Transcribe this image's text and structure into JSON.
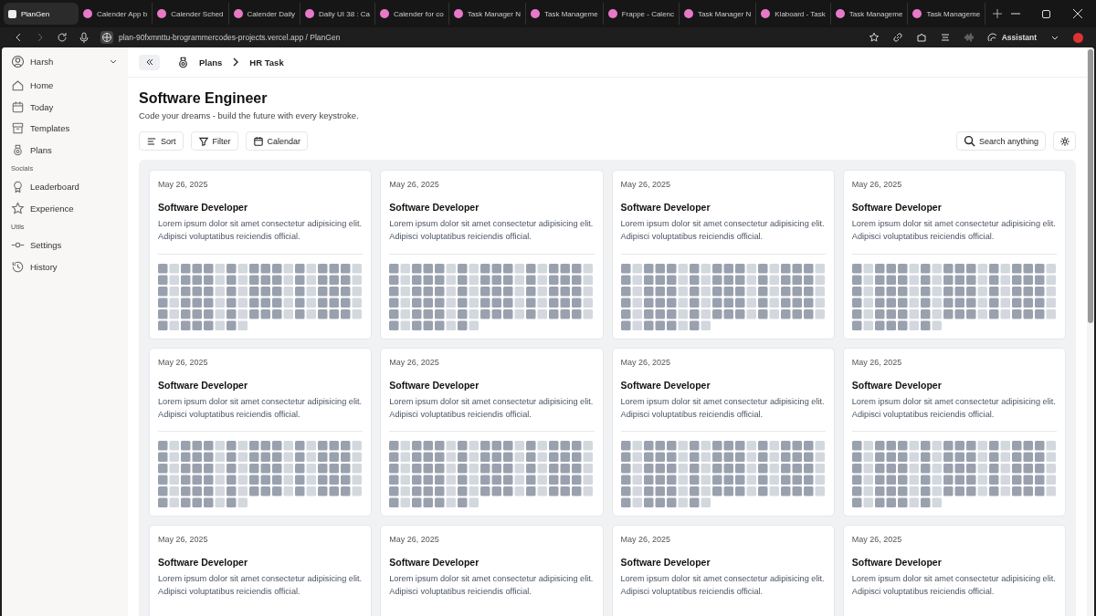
{
  "browser": {
    "tabs": [
      {
        "title": "PlanGen",
        "selected": true
      },
      {
        "title": "Calender App b",
        "selected": false
      },
      {
        "title": "Calender Sched",
        "selected": false
      },
      {
        "title": "Calender Daily",
        "selected": false
      },
      {
        "title": "Daily UI 38 : Ca",
        "selected": false
      },
      {
        "title": "Calender for co",
        "selected": false
      },
      {
        "title": "Task Manager N",
        "selected": false
      },
      {
        "title": "Task Manageme",
        "selected": false
      },
      {
        "title": "Frappe - Calenc",
        "selected": false
      },
      {
        "title": "Task Manager N",
        "selected": false
      },
      {
        "title": "Klaboard - Task",
        "selected": false
      },
      {
        "title": "Task Manageme",
        "selected": false
      },
      {
        "title": "Task Manageme",
        "selected": false
      }
    ],
    "url": "plan-90fxmnttu-brogrammercodes-projects.vercel.app / PlanGen",
    "assistant": "Assistant"
  },
  "sidebar": {
    "user": "Harsh",
    "sections": [
      {
        "items": [
          {
            "label": "Home"
          },
          {
            "label": "Today"
          },
          {
            "label": "Templates"
          },
          {
            "label": "Plans"
          }
        ]
      },
      {
        "heading": "Socials",
        "items": [
          {
            "label": "Leaderboard"
          },
          {
            "label": "Experience"
          }
        ]
      },
      {
        "heading": "Utils",
        "items": [
          {
            "label": "Settings"
          },
          {
            "label": "History"
          }
        ]
      }
    ]
  },
  "breadcrumb": [
    "Plans",
    "HR Task"
  ],
  "page": {
    "title": "Software Engineer",
    "subtitle": "Code your dreams - build the future with every keystroke."
  },
  "toolbar": {
    "buttons": [
      {
        "label": "Sort"
      },
      {
        "label": "Filter"
      },
      {
        "label": "Calendar"
      }
    ],
    "search": "Search anything"
  },
  "cards": [
    {
      "date": "May 26, 2025",
      "title": "Software Developer",
      "description": "Lorem ipsum dolor sit amet consectetur adipisicing elit. Adipisci voluptatibus reiciendis official."
    },
    {
      "date": "May 26, 2025",
      "title": "Software Developer",
      "description": "Lorem ipsum dolor sit amet consectetur adipisicing elit. Adipisci voluptatibus reiciendis official."
    },
    {
      "date": "May 26, 2025",
      "title": "Software Developer",
      "description": "Lorem ipsum dolor sit amet consectetur adipisicing elit. Adipisci voluptatibus reiciendis official."
    },
    {
      "date": "May 26, 2025",
      "title": "Software Developer",
      "description": "Lorem ipsum dolor sit amet consectetur adipisicing elit. Adipisci voluptatibus reiciendis official."
    },
    {
      "date": "May 26, 2025",
      "title": "Software Developer",
      "description": "Lorem ipsum dolor sit amet consectetur adipisicing elit. Adipisci voluptatibus reiciendis official."
    },
    {
      "date": "May 26, 2025",
      "title": "Software Developer",
      "description": "Lorem ipsum dolor sit amet consectetur adipisicing elit. Adipisci voluptatibus reiciendis official."
    },
    {
      "date": "May 26, 2025",
      "title": "Software Developer",
      "description": "Lorem ipsum dolor sit amet consectetur adipisicing elit. Adipisci voluptatibus reiciendis official."
    },
    {
      "date": "May 26, 2025",
      "title": "Software Developer",
      "description": "Lorem ipsum dolor sit amet consectetur adipisicing elit. Adipisci voluptatibus reiciendis official."
    },
    {
      "date": "May 26, 2025",
      "title": "Software Developer",
      "description": "Lorem ipsum dolor sit amet consectetur adipisicing elit. Adipisci voluptatibus reiciendis official."
    },
    {
      "date": "May 26, 2025",
      "title": "Software Developer",
      "description": "Lorem ipsum dolor sit amet consectetur adipisicing elit. Adipisci voluptatibus reiciendis official."
    },
    {
      "date": "May 26, 2025",
      "title": "Software Developer",
      "description": "Lorem ipsum dolor sit amet consectetur adipisicing elit. Adipisci voluptatibus reiciendis official."
    },
    {
      "date": "May 26, 2025",
      "title": "Software Developer",
      "description": "Lorem ipsum dolor sit amet consectetur adipisicing elit. Adipisci voluptatibus reiciendis official."
    }
  ]
}
